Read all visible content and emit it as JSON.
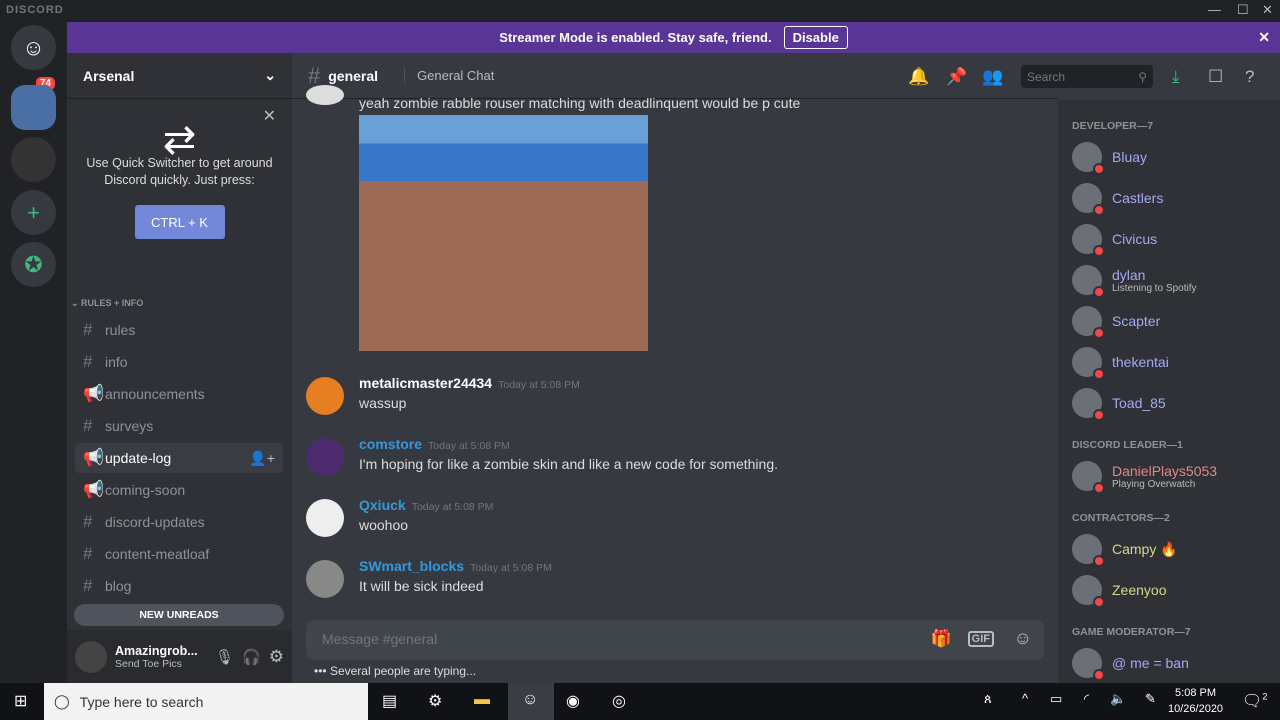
{
  "app": {
    "title": "DISCORD"
  },
  "banner": {
    "text": "Streamer Mode is enabled. Stay safe, friend.",
    "button": "Disable"
  },
  "servers": {
    "mention_badge": "74"
  },
  "guild": {
    "name": "Arsenal"
  },
  "quick_switcher": {
    "text1": "Use Quick Switcher to get around",
    "text2": "Discord quickly. Just press:",
    "shortcut": "CTRL + K"
  },
  "channels": {
    "category": "RULES + INFO",
    "items": [
      {
        "name": "rules",
        "type": "text"
      },
      {
        "name": "info",
        "type": "text"
      },
      {
        "name": "announcements",
        "type": "news"
      },
      {
        "name": "surveys",
        "type": "text"
      },
      {
        "name": "update-log",
        "type": "news"
      },
      {
        "name": "coming-soon",
        "type": "news"
      },
      {
        "name": "discord-updates",
        "type": "text"
      },
      {
        "name": "content-meatloaf",
        "type": "text"
      },
      {
        "name": "blog",
        "type": "text"
      }
    ],
    "new_unreads": "NEW UNREADS"
  },
  "user": {
    "name": "Amazingrob...",
    "status": "Send Toe Pics"
  },
  "header": {
    "channel": "general",
    "topic": "General Chat",
    "search_placeholder": "Search"
  },
  "messages": [
    {
      "text": "yeah zombie rabble rouser matching with deadlinquent would be p cute"
    },
    {
      "author": "metalicmaster24434",
      "time": "Today at 5:08 PM",
      "text": "wassup",
      "color": "#ffffff"
    },
    {
      "author": "comstore",
      "time": "Today at 5:08 PM",
      "text": "I'm hoping for like a zombie skin and like a new code for something.",
      "color": "#3498db"
    },
    {
      "author": "Qxiuck",
      "time": "Today at 5:08 PM",
      "text": "woohoo",
      "color": "#3498db"
    },
    {
      "author": "SWmart_blocks",
      "time": "Today at 5:08 PM",
      "text": "It will be sick indeed",
      "color": "#3498db"
    }
  ],
  "composer": {
    "placeholder": "Message #general",
    "typing": "Several people are typing..."
  },
  "members": {
    "roles": [
      {
        "name": "DEVELOPER—7",
        "color": "#a5a9f5",
        "members": [
          {
            "name": "Bluay"
          },
          {
            "name": "Castlers"
          },
          {
            "name": "Civicus"
          },
          {
            "name": "dylan",
            "status": "Listening to Spotify"
          },
          {
            "name": "Scapter"
          },
          {
            "name": "thekentai"
          },
          {
            "name": "Toad_85"
          }
        ]
      },
      {
        "name": "DISCORD LEADER—1",
        "color": "#e3868d",
        "members": [
          {
            "name": "DanielPlays5053",
            "status": "Playing Overwatch"
          }
        ]
      },
      {
        "name": "CONTRACTORS—2",
        "color": "#d4d98a",
        "members": [
          {
            "name": "Campy 🔥"
          },
          {
            "name": "Zeenyoo"
          }
        ]
      },
      {
        "name": "GAME MODERATOR—7",
        "color": "#a5a9f5",
        "members": [
          {
            "name": "@ me = ban"
          }
        ]
      }
    ]
  },
  "taskbar": {
    "search_placeholder": "Type here to search",
    "time": "5:08 PM",
    "date": "10/26/2020",
    "notifications": "2"
  }
}
